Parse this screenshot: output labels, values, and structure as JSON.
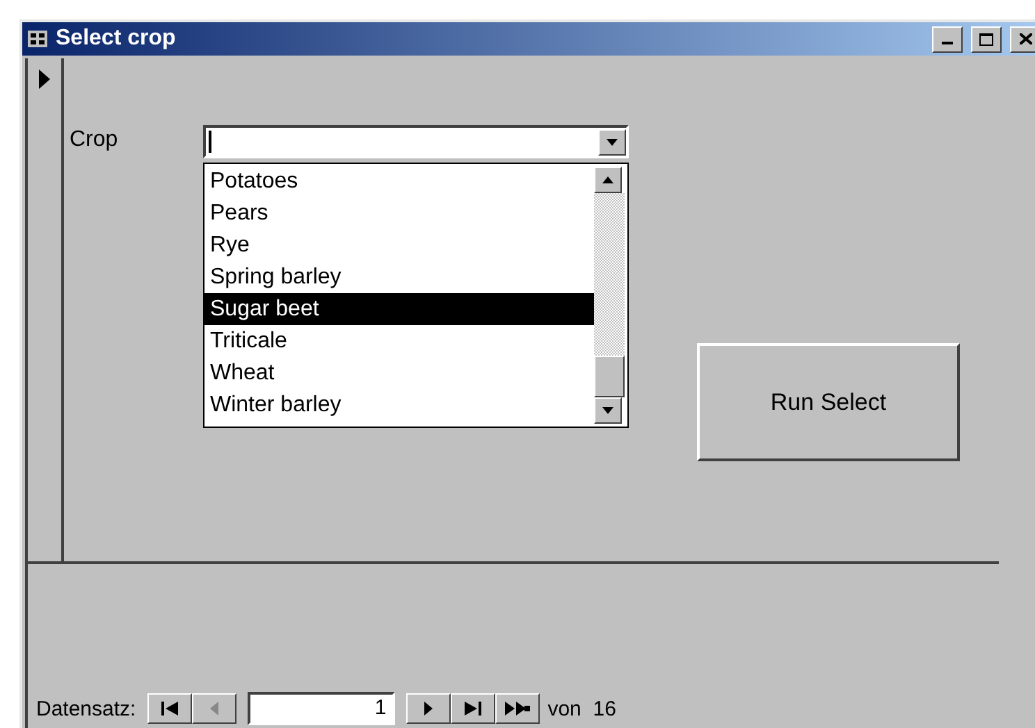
{
  "window": {
    "title": "Select crop"
  },
  "record_selector": {
    "current": true
  },
  "form": {
    "crop_label": "Crop",
    "crop_options": [
      {
        "label": "Potatoes",
        "selected": false
      },
      {
        "label": "Pears",
        "selected": false
      },
      {
        "label": "Rye",
        "selected": false
      },
      {
        "label": "Spring barley",
        "selected": false
      },
      {
        "label": "Sugar beet",
        "selected": true
      },
      {
        "label": "Triticale",
        "selected": false
      },
      {
        "label": "Wheat",
        "selected": false
      },
      {
        "label": "Winter barley",
        "selected": false
      }
    ],
    "run_button": "Run Select"
  },
  "navigation": {
    "label": "Datensatz:",
    "record": "1",
    "total": "von  16",
    "buttons": [
      {
        "kind": "first",
        "disabled": false
      },
      {
        "kind": "prev",
        "disabled": true
      },
      {
        "kind": "next",
        "disabled": false
      },
      {
        "kind": "last",
        "disabled": false
      },
      {
        "kind": "new",
        "disabled": false
      }
    ]
  }
}
